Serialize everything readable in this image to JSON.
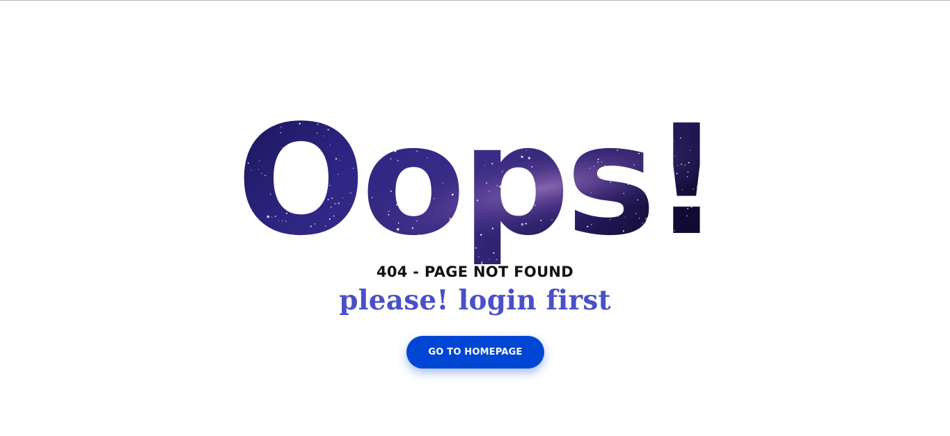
{
  "headline": "Oops!",
  "error_text": "404 - PAGE NOT FOUND",
  "message": "please! login first",
  "button": {
    "label": "GO TO HOMEPAGE"
  },
  "colors": {
    "message": "#4950c8",
    "button_bg": "#0046d5",
    "galaxy_dark": "#120c3f",
    "galaxy_mid": "#3a2a8a",
    "galaxy_glow": "#8a5fae"
  }
}
